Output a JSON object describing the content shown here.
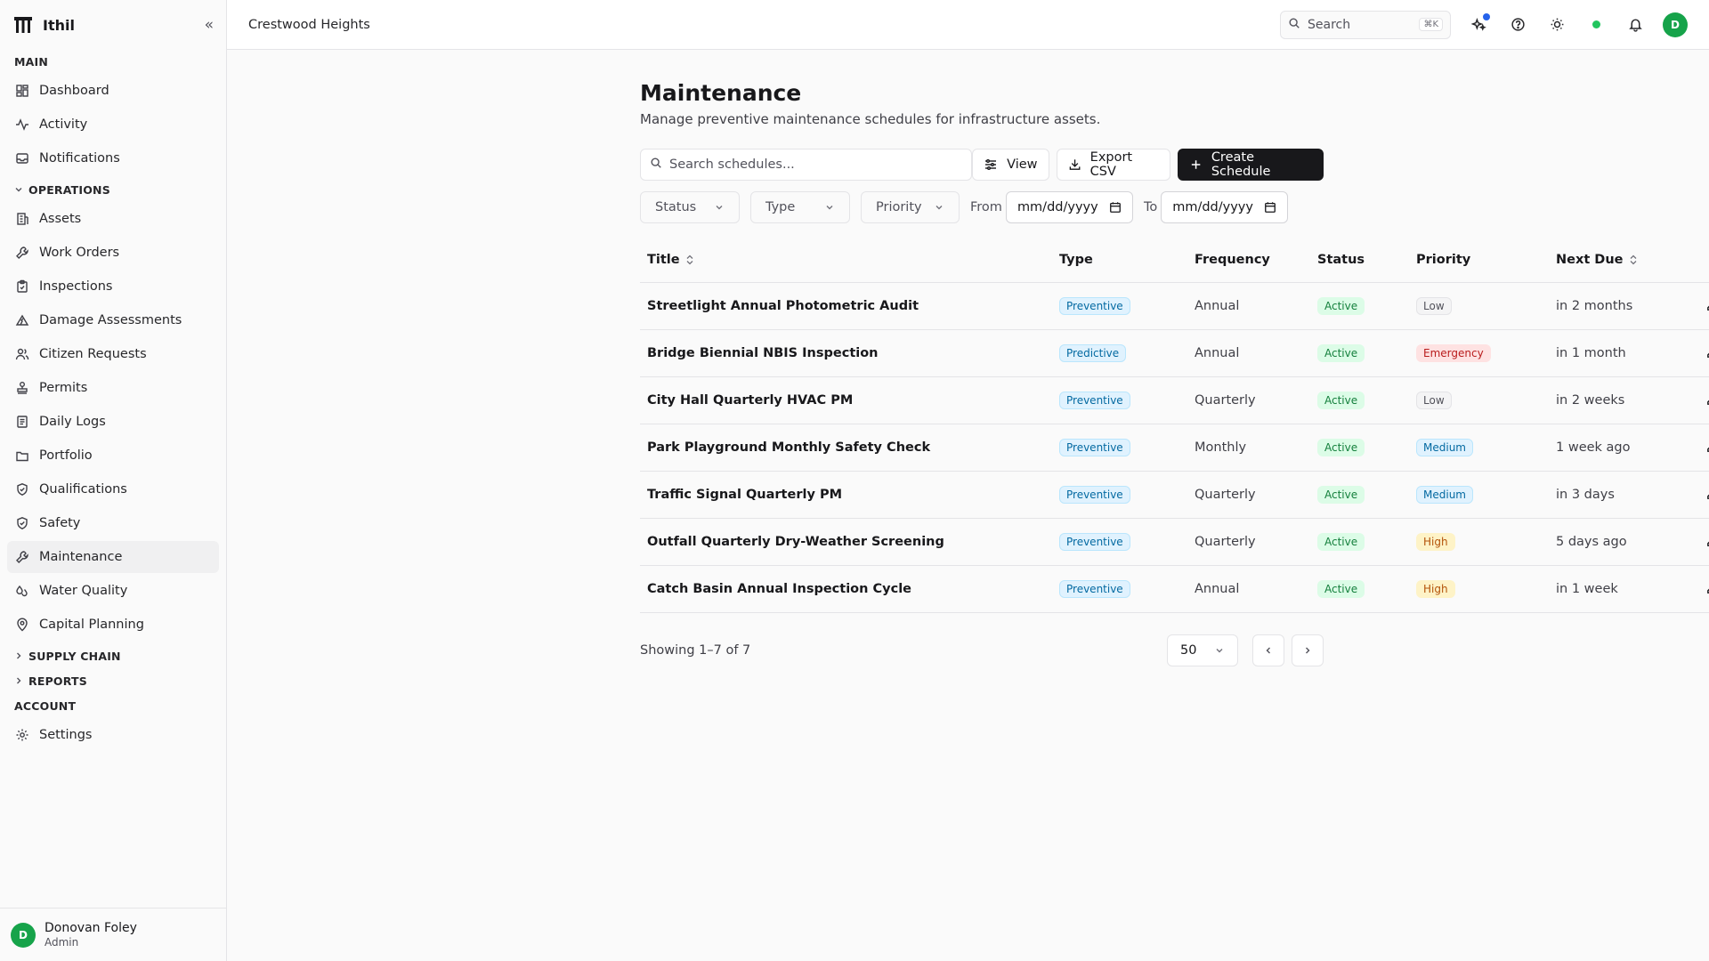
{
  "app": {
    "name": "Ithil",
    "collapse_icon": "«"
  },
  "sidebar": {
    "main_label": "MAIN",
    "main_items": [
      {
        "label": "Dashboard",
        "icon": "grid-icon"
      },
      {
        "label": "Activity",
        "icon": "activity-icon"
      },
      {
        "label": "Notifications",
        "icon": "inbox-icon"
      }
    ],
    "operations_label": "OPERATIONS",
    "operations_items": [
      {
        "label": "Assets",
        "icon": "building-icon"
      },
      {
        "label": "Work Orders",
        "icon": "wrench-icon"
      },
      {
        "label": "Inspections",
        "icon": "clipboard-icon"
      },
      {
        "label": "Damage Assessments",
        "icon": "damage-icon"
      },
      {
        "label": "Citizen Requests",
        "icon": "users-icon"
      },
      {
        "label": "Permits",
        "icon": "stamp-icon"
      },
      {
        "label": "Daily Logs",
        "icon": "book-icon"
      },
      {
        "label": "Portfolio",
        "icon": "folder-icon"
      },
      {
        "label": "Qualifications",
        "icon": "shield-check-icon"
      },
      {
        "label": "Safety",
        "icon": "shield-icon"
      },
      {
        "label": "Maintenance",
        "icon": "wrench-icon"
      },
      {
        "label": "Water Quality",
        "icon": "droplets-icon"
      },
      {
        "label": "Capital Planning",
        "icon": "map-pin-icon"
      }
    ],
    "supply_chain_label": "SUPPLY CHAIN",
    "reports_label": "REPORTS",
    "account_label": "ACCOUNT",
    "account_items": [
      {
        "label": "Settings",
        "icon": "gear-icon"
      }
    ],
    "user": {
      "initial": "D",
      "name": "Donovan Foley",
      "role": "Admin"
    }
  },
  "topbar": {
    "title": "Crestwood Heights",
    "search_label": "Search",
    "search_shortcut": "⌘K",
    "user_initial": "D"
  },
  "page": {
    "title": "Maintenance",
    "subtitle": "Manage preventive maintenance schedules for infrastructure assets.",
    "search_placeholder": "Search schedules...",
    "view_label": "View",
    "export_label": "Export CSV",
    "create_label": "Create Schedule",
    "filters": {
      "status": "Status",
      "type": "Type",
      "priority": "Priority",
      "from_label": "From",
      "to_label": "To",
      "date_placeholder": "mm/dd/yyyy"
    }
  },
  "table": {
    "columns": [
      "Title",
      "Type",
      "Frequency",
      "Status",
      "Priority",
      "Next Due"
    ],
    "rows": [
      {
        "title": "Streetlight Annual Photometric Audit",
        "type": "Preventive",
        "frequency": "Annual",
        "status": "Active",
        "priority": "Low",
        "next_due": "in 2 months"
      },
      {
        "title": "Bridge Biennial NBIS Inspection",
        "type": "Predictive",
        "frequency": "Annual",
        "status": "Active",
        "priority": "Emergency",
        "next_due": "in 1 month"
      },
      {
        "title": "City Hall Quarterly HVAC PM",
        "type": "Preventive",
        "frequency": "Quarterly",
        "status": "Active",
        "priority": "Low",
        "next_due": "in 2 weeks"
      },
      {
        "title": "Park Playground Monthly Safety Check",
        "type": "Preventive",
        "frequency": "Monthly",
        "status": "Active",
        "priority": "Medium",
        "next_due": "1 week ago"
      },
      {
        "title": "Traffic Signal Quarterly PM",
        "type": "Preventive",
        "frequency": "Quarterly",
        "status": "Active",
        "priority": "Medium",
        "next_due": "in 3 days"
      },
      {
        "title": "Outfall Quarterly Dry-Weather Screening",
        "type": "Preventive",
        "frequency": "Quarterly",
        "status": "Active",
        "priority": "High",
        "next_due": "5 days ago"
      },
      {
        "title": "Catch Basin Annual Inspection Cycle",
        "type": "Preventive",
        "frequency": "Annual",
        "status": "Active",
        "priority": "High",
        "next_due": "in 1 week"
      }
    ]
  },
  "pagination": {
    "showing": "Showing 1–7 of 7",
    "per_page": "50"
  },
  "colors": {
    "accent": "#18181b",
    "status_online": "#22c55e",
    "avatar": "#16a34a",
    "notification_dot": "#2563eb"
  }
}
